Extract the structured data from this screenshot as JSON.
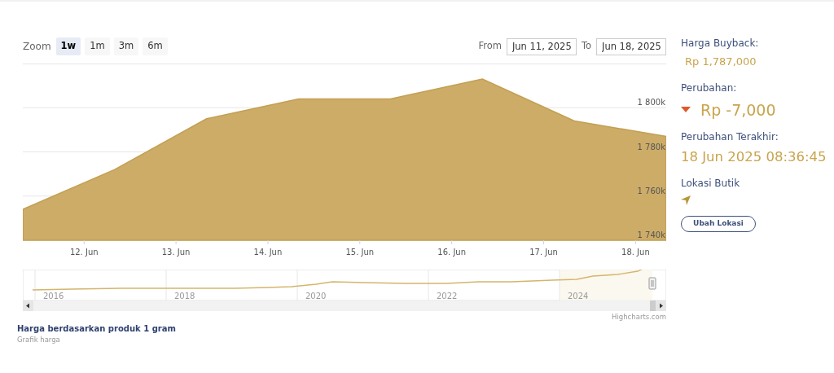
{
  "range_selector": {
    "label": "Zoom",
    "buttons": [
      {
        "label": "1w",
        "selected": true
      },
      {
        "label": "1m",
        "selected": false
      },
      {
        "label": "3m",
        "selected": false
      },
      {
        "label": "6m",
        "selected": false
      }
    ]
  },
  "date_range": {
    "from_label": "From",
    "from": "Jun 11, 2025",
    "to_label": "To",
    "to": "Jun 18, 2025"
  },
  "chart": {
    "chart_data": {
      "type": "area",
      "categories": [
        null,
        "12. Jun",
        "13. Jun",
        "14. Jun",
        "15. Jun",
        "16. Jun",
        "17. Jun",
        "18. Jun"
      ],
      "series": [
        {
          "color": "#cdac68",
          "values": [
            1754000,
            1772000,
            1795000,
            1804000,
            1804000,
            1813000,
            1794000,
            1787000
          ]
        }
      ],
      "ylim": [
        1740000,
        1820000
      ],
      "grid": true,
      "yticks": [
        {
          "value": 1740000,
          "label": "1 740k"
        },
        {
          "value": 1760000,
          "label": "1 760k"
        },
        {
          "value": 1780000,
          "label": "1 780k"
        },
        {
          "value": 1800000,
          "label": "1 800k"
        }
      ]
    }
  },
  "navigator": {
    "year_labels": [
      "2016",
      "2018",
      "2020",
      "2022",
      "2024"
    ]
  },
  "credits": "Highcharts.com",
  "caption": {
    "title": "Harga berdasarkan produk 1 gram",
    "subtitle": "Grafik harga"
  },
  "info_panel": {
    "buyback": {
      "label": "Harga Buyback:",
      "value": "Rp 1,787,000"
    },
    "change": {
      "label": "Perubahan:",
      "value": "Rp -7,000"
    },
    "last_change": {
      "label": "Perubahan Terakhir:",
      "value": "18 Jun 2025 08:36:45"
    },
    "location": {
      "label": "Lokasi Butik",
      "button": "Ubah Lokasi"
    }
  }
}
